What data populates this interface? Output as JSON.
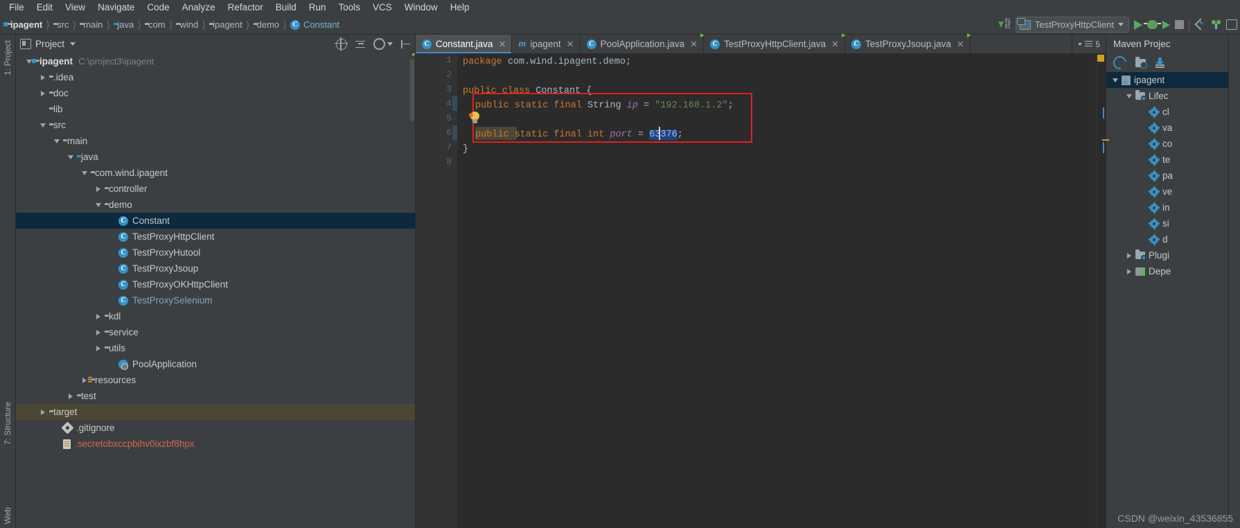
{
  "menu": {
    "items": [
      "File",
      "Edit",
      "View",
      "Navigate",
      "Code",
      "Analyze",
      "Refactor",
      "Build",
      "Run",
      "Tools",
      "VCS",
      "Window",
      "Help"
    ]
  },
  "breadcrumb": {
    "items": [
      {
        "label": "ipagent",
        "icon": "module-icon"
      },
      {
        "label": "src",
        "icon": "folder-icon"
      },
      {
        "label": "main",
        "icon": "folder-icon"
      },
      {
        "label": "java",
        "icon": "source-folder-icon"
      },
      {
        "label": "com",
        "icon": "package-icon"
      },
      {
        "label": "wind",
        "icon": "package-icon"
      },
      {
        "label": "ipagent",
        "icon": "package-icon"
      },
      {
        "label": "demo",
        "icon": "package-icon"
      },
      {
        "label": "Constant",
        "icon": "class-icon"
      }
    ]
  },
  "toolbar": {
    "run_configuration": "TestProxyHttpClient",
    "buttons": [
      "run",
      "debug",
      "run-with-coverage",
      "stop",
      "attach-debugger",
      "event-log",
      "window"
    ]
  },
  "project_panel": {
    "title": "Project",
    "vertical_tabs": [
      "1: Project",
      "7: Structure",
      "Web"
    ],
    "tree": [
      {
        "label": "ipagent",
        "path": "C:\\project3\\ipagent",
        "indent": 0,
        "twisty": "down",
        "icon": "module-icon",
        "bold": true
      },
      {
        "label": ".idea",
        "indent": 1,
        "twisty": "right",
        "icon": "folder-icon"
      },
      {
        "label": "doc",
        "indent": 1,
        "twisty": "right",
        "icon": "folder-icon"
      },
      {
        "label": "lib",
        "indent": 1,
        "twisty": "none",
        "icon": "lib-folder-icon"
      },
      {
        "label": "src",
        "indent": 1,
        "twisty": "down",
        "icon": "folder-icon"
      },
      {
        "label": "main",
        "indent": 2,
        "twisty": "down",
        "icon": "folder-icon"
      },
      {
        "label": "java",
        "indent": 3,
        "twisty": "down",
        "icon": "source-folder-icon"
      },
      {
        "label": "com.wind.ipagent",
        "indent": 4,
        "twisty": "down",
        "icon": "package-icon"
      },
      {
        "label": "controller",
        "indent": 5,
        "twisty": "right",
        "icon": "package-icon"
      },
      {
        "label": "demo",
        "indent": 5,
        "twisty": "down",
        "icon": "package-icon"
      },
      {
        "label": "Constant",
        "indent": 6,
        "twisty": "none",
        "icon": "class-icon",
        "selected": true
      },
      {
        "label": "TestProxyHttpClient",
        "indent": 6,
        "twisty": "none",
        "icon": "runnable-class-icon"
      },
      {
        "label": "TestProxyHutool",
        "indent": 6,
        "twisty": "none",
        "icon": "runnable-class-icon"
      },
      {
        "label": "TestProxyJsoup",
        "indent": 6,
        "twisty": "none",
        "icon": "runnable-class-icon"
      },
      {
        "label": "TestProxyOKHttpClient",
        "indent": 6,
        "twisty": "none",
        "icon": "runnable-class-icon"
      },
      {
        "label": "TestProxySelenium",
        "indent": 6,
        "twisty": "none",
        "icon": "runnable-class-icon",
        "style": "selenium"
      },
      {
        "label": "kdl",
        "indent": 5,
        "twisty": "right",
        "icon": "package-icon"
      },
      {
        "label": "service",
        "indent": 5,
        "twisty": "right",
        "icon": "package-icon"
      },
      {
        "label": "utils",
        "indent": 5,
        "twisty": "right",
        "icon": "package-icon"
      },
      {
        "label": "PoolApplication",
        "indent": 6,
        "twisty": "none",
        "icon": "spring-class-icon"
      },
      {
        "label": "resources",
        "indent": 4,
        "twisty": "right",
        "icon": "resources-folder-icon"
      },
      {
        "label": "test",
        "indent": 3,
        "twisty": "right",
        "icon": "folder-icon"
      },
      {
        "label": "target",
        "indent": 1,
        "twisty": "right",
        "icon": "folder-icon",
        "highlight": "target"
      },
      {
        "label": ".gitignore",
        "indent": 2,
        "twisty": "none",
        "icon": "gitignore-icon"
      },
      {
        "label": ".secretobxccpbihv0ixzbf8hpx",
        "indent": 2,
        "twisty": "none",
        "icon": "file-icon",
        "style": "secret"
      }
    ]
  },
  "editor": {
    "tabs": [
      {
        "label": "Constant.java",
        "icon": "class-icon",
        "active": true,
        "closeable": true
      },
      {
        "label": "ipagent",
        "icon": "maven-icon",
        "active": false,
        "closeable": true
      },
      {
        "label": "PoolApplication.java",
        "icon": "spring-class-icon",
        "active": false,
        "closeable": true
      },
      {
        "label": "TestProxyHttpClient.java",
        "icon": "runnable-class-icon",
        "active": false,
        "closeable": true
      },
      {
        "label": "TestProxyJsoup.java",
        "icon": "runnable-class-icon",
        "active": false,
        "closeable": true
      }
    ],
    "tab_overflow_count": "5",
    "line_numbers": [
      "1",
      "2",
      "3",
      "4",
      "5",
      "6",
      "7",
      "8"
    ],
    "code_lines": [
      {
        "n": 1,
        "text": "package com.wind.ipagent.demo;"
      },
      {
        "n": 2,
        "text": ""
      },
      {
        "n": 3,
        "text": "public class Constant {"
      },
      {
        "n": 4,
        "text": "    public static final String ip = \"192.168.1.2\";"
      },
      {
        "n": 5,
        "text": ""
      },
      {
        "n": 6,
        "text": "    public static final int port = 63376;"
      },
      {
        "n": 7,
        "text": "}"
      },
      {
        "n": 8,
        "text": ""
      }
    ],
    "selected_value": "63376",
    "string_value": "\"192.168.1.2\"",
    "field_ip": "ip",
    "field_port": "port",
    "class_name": "Constant",
    "package_name": "com.wind.ipagent.demo;"
  },
  "maven_panel": {
    "title": "Maven Projec",
    "tree": [
      {
        "label": "ipagent",
        "indent": 0,
        "twisty": "down",
        "icon": "maven-module-icon",
        "selected": true
      },
      {
        "label": "Lifec",
        "indent": 1,
        "twisty": "down",
        "icon": "lifecycle-folder-icon"
      },
      {
        "label": "cl",
        "indent": 2,
        "twisty": "none",
        "icon": "goal-icon"
      },
      {
        "label": "va",
        "indent": 2,
        "twisty": "none",
        "icon": "goal-icon"
      },
      {
        "label": "co",
        "indent": 2,
        "twisty": "none",
        "icon": "goal-icon"
      },
      {
        "label": "te",
        "indent": 2,
        "twisty": "none",
        "icon": "goal-icon"
      },
      {
        "label": "pa",
        "indent": 2,
        "twisty": "none",
        "icon": "goal-icon"
      },
      {
        "label": "ve",
        "indent": 2,
        "twisty": "none",
        "icon": "goal-icon"
      },
      {
        "label": "in",
        "indent": 2,
        "twisty": "none",
        "icon": "goal-icon"
      },
      {
        "label": "si",
        "indent": 2,
        "twisty": "none",
        "icon": "goal-icon"
      },
      {
        "label": "d",
        "indent": 2,
        "twisty": "none",
        "icon": "goal-icon"
      },
      {
        "label": "Plugi",
        "indent": 1,
        "twisty": "right",
        "icon": "plugins-folder-icon"
      },
      {
        "label": "Depe",
        "indent": 1,
        "twisty": "right",
        "icon": "dependencies-icon"
      }
    ]
  },
  "watermark": "CSDN @weixin_43536855",
  "colors": {
    "accent": "#3592c4",
    "selection": "#0d293e",
    "highlight_box": "#e02020",
    "editor_bg": "#2b2b2b",
    "panel_bg": "#3c3f41"
  }
}
